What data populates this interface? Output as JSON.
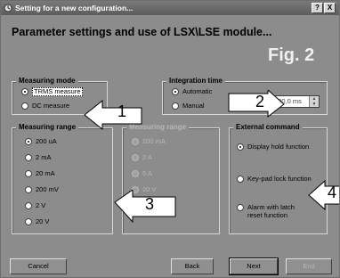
{
  "window": {
    "title": "Setting for a new configuration...",
    "help_label": "?",
    "close_label": "X"
  },
  "heading": "Parameter settings and use of LSX\\LSE module...",
  "fig_label": "Fig. 2",
  "measuring_mode": {
    "legend": "Measuring mode",
    "options": [
      "TRMS measure",
      "DC measure"
    ],
    "selected": "TRMS measure"
  },
  "integration_time": {
    "legend": "Integration time",
    "options": [
      "Automatic",
      "Manual"
    ],
    "selected": "Automatic",
    "value": "100,0 ms"
  },
  "measuring_range": {
    "legend": "Measuring range",
    "options": [
      "200 uA",
      "2 mA",
      "20 mA",
      "200 mV",
      "2 V",
      "20 V"
    ],
    "selected": "200 uA"
  },
  "measuring_range_disabled": {
    "legend": "Measuring range",
    "options": [
      "200 mA",
      "2 A",
      "5 A",
      "20 V"
    ]
  },
  "external_command": {
    "legend": "External command",
    "options": [
      "Display hold function",
      "Key-pad lock function",
      "Alarm with latch reset function"
    ],
    "selected": "Display hold function"
  },
  "callouts": [
    "1",
    "2",
    "3",
    "4"
  ],
  "buttons": {
    "cancel": "Cancel",
    "back": "Back",
    "next": "Next",
    "end": "End"
  },
  "colors": {
    "window_bg": "#8c8c8c",
    "title_bar": "#5c5c5c",
    "fig_label": "#f0f0f0",
    "disabled_text": "#b8b8b8"
  }
}
